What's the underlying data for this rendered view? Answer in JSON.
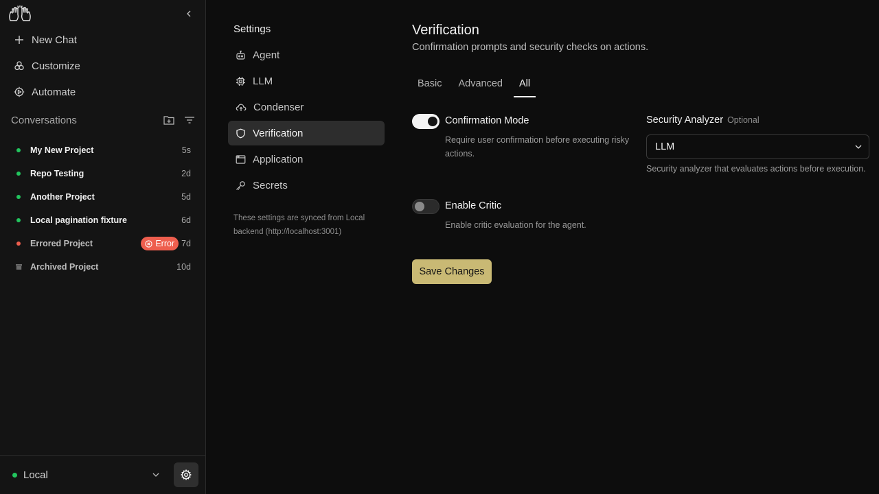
{
  "sidebar": {
    "nav": [
      {
        "label": "New Chat",
        "icon": "plus-icon"
      },
      {
        "label": "Customize",
        "icon": "customize-icon"
      },
      {
        "label": "Automate",
        "icon": "automate-icon"
      }
    ],
    "conversations_title": "Conversations",
    "conversations": [
      {
        "name": "My New Project",
        "time": "5s",
        "status": "active",
        "color": "#22c55e"
      },
      {
        "name": "Repo Testing",
        "time": "2d",
        "status": "active",
        "color": "#22c55e"
      },
      {
        "name": "Another Project",
        "time": "5d",
        "status": "active",
        "color": "#22c55e"
      },
      {
        "name": "Local pagination fixture",
        "time": "6d",
        "status": "active",
        "color": "#22c55e"
      },
      {
        "name": "Errored Project",
        "time": "7d",
        "status": "error",
        "color": "#ee5e4e",
        "badge": "Error"
      },
      {
        "name": "Archived Project",
        "time": "10d",
        "status": "archived",
        "color": "#6b6b6b"
      }
    ],
    "footer": {
      "backend_label": "Local"
    }
  },
  "settings_nav": {
    "title": "Settings",
    "items": [
      {
        "label": "Agent",
        "icon": "robot-icon"
      },
      {
        "label": "LLM",
        "icon": "chip-icon"
      },
      {
        "label": "Condenser",
        "icon": "cloud-icon"
      },
      {
        "label": "Verification",
        "icon": "shield-icon",
        "active": true
      },
      {
        "label": "Application",
        "icon": "window-icon"
      },
      {
        "label": "Secrets",
        "icon": "key-icon"
      }
    ],
    "sync_note": "These settings are synced from Local backend (http://localhost:3001)"
  },
  "main": {
    "title": "Verification",
    "subtitle": "Confirmation prompts and security checks on actions.",
    "tabs": [
      {
        "label": "Basic"
      },
      {
        "label": "Advanced"
      },
      {
        "label": "All",
        "active": true
      }
    ],
    "confirmation": {
      "label": "Confirmation Mode",
      "description": "Require user confirmation before executing risky actions.",
      "enabled": true
    },
    "security_analyzer": {
      "label": "Security Analyzer",
      "optional_tag": "Optional",
      "value": "LLM",
      "description": "Security analyzer that evaluates actions before execution."
    },
    "critic": {
      "label": "Enable Critic",
      "description": "Enable critic evaluation for the agent.",
      "enabled": false
    },
    "save_label": "Save Changes"
  },
  "colors": {
    "accent": "#c9b974",
    "active_dot": "#22c55e",
    "error": "#ee5e4e"
  }
}
